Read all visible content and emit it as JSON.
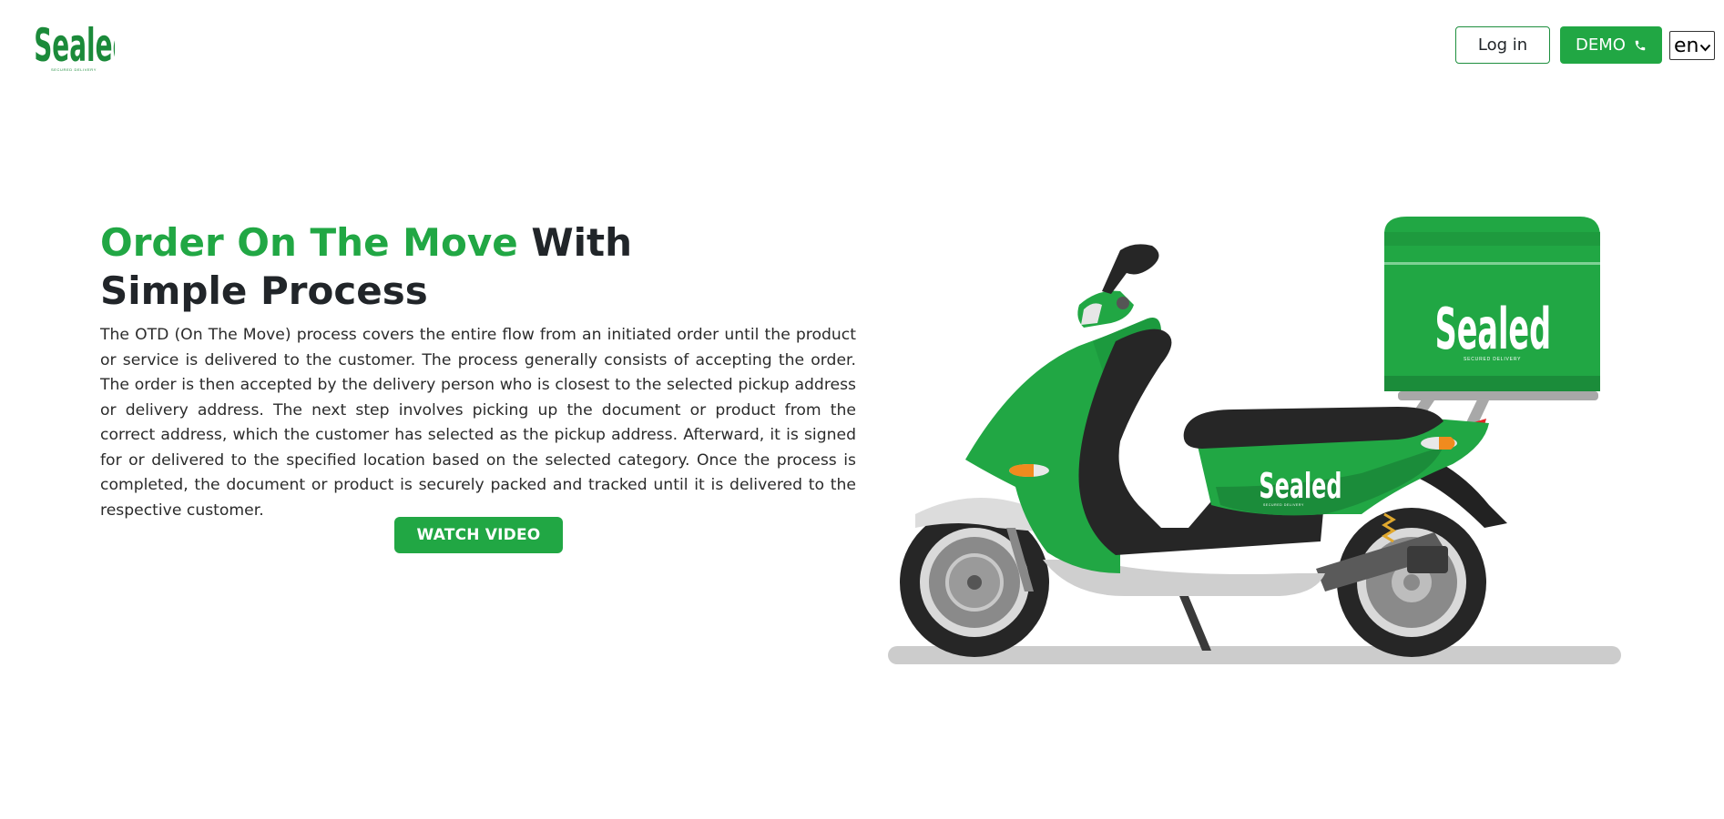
{
  "brand": {
    "name": "Sealed",
    "tagline": "SECURED DELIVERY",
    "color": "#21a744"
  },
  "header": {
    "login_label": "Log in",
    "demo_label": "DEMO",
    "demo_icon": "phone-icon",
    "language": "en"
  },
  "hero": {
    "title_accent": "Order On The Move",
    "title_rest": " With Simple Process",
    "body": "The OTD (On The Move) process covers the entire flow from an initiated order until the product or service is delivered to the customer. The process generally consists of accepting the order. The order is then accepted by the delivery person who is closest to the selected pickup address or delivery address. The next step involves picking up the document or product from the correct address, which the customer has selected as the pickup address. Afterward, it is signed for or delivered to the specified location based on the selected category. Once the process is completed, the document or product is securely packed and tracked until it is delivered to the respective customer.",
    "cta_label": "WATCH VIDEO"
  },
  "illustration": {
    "box_brand": "Sealed",
    "box_tagline": "SECURED DELIVERY",
    "body_brand": "Sealed",
    "body_tagline": "SECURED DELIVERY"
  }
}
